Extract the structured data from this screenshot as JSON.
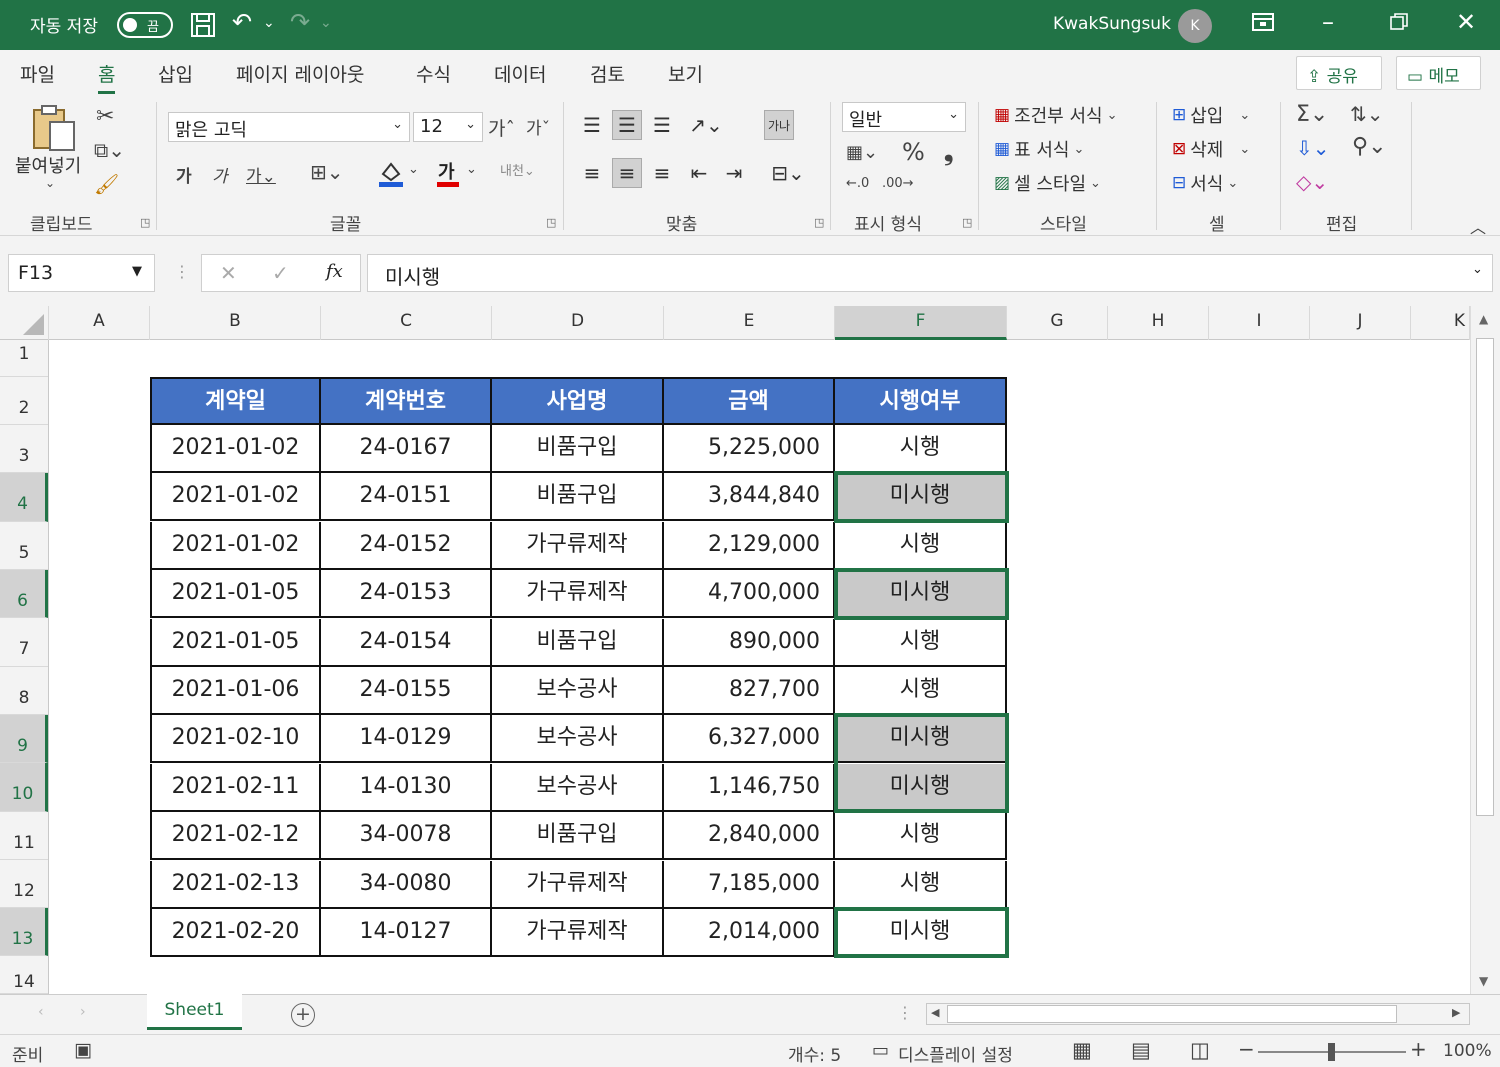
{
  "titlebar": {
    "autosave_label": "자동 저장",
    "autosave_state": "끔",
    "user_name": "KwakSungsuk",
    "avatar_initial": "K"
  },
  "menu": {
    "tabs": [
      "파일",
      "홈",
      "삽입",
      "페이지 레이아웃",
      "수식",
      "데이터",
      "검토",
      "보기"
    ],
    "active_tab": "홈",
    "share_label": "공유",
    "memo_label": "메모"
  },
  "ribbon": {
    "paste_label": "붙여넣기",
    "clipboard_group": "클립보드",
    "font_name": "맑은 고딕",
    "font_size": "12",
    "font_group": "글꼴",
    "align_group": "맞춤",
    "number_format": "일반",
    "number_group": "표시 형식",
    "cond_format": "조건부 서식",
    "table_format": "표 서식",
    "cell_style": "셀 스타일",
    "style_group": "스타일",
    "insert": "삽입",
    "delete": "삭제",
    "format": "서식",
    "cells_group": "셀",
    "edit_group": "편집"
  },
  "formula_bar": {
    "name_box": "F13",
    "formula": "미시행"
  },
  "columns": [
    "A",
    "B",
    "C",
    "D",
    "E",
    "F",
    "G",
    "H",
    "I",
    "J",
    "K"
  ],
  "selected_column": "F",
  "rows": [
    "1",
    "2",
    "3",
    "4",
    "5",
    "6",
    "7",
    "8",
    "9",
    "10",
    "11",
    "12",
    "13",
    "14"
  ],
  "selected_rows": [
    "4",
    "6",
    "9",
    "10",
    "13"
  ],
  "table": {
    "headers": [
      "계약일",
      "계약번호",
      "사업명",
      "금액",
      "시행여부"
    ],
    "rows": [
      [
        "2021-01-02",
        "24-0167",
        "비품구입",
        "5,225,000",
        "시행"
      ],
      [
        "2021-01-02",
        "24-0151",
        "비품구입",
        "3,844,840",
        "미시행"
      ],
      [
        "2021-01-02",
        "24-0152",
        "가구류제작",
        "2,129,000",
        "시행"
      ],
      [
        "2021-01-05",
        "24-0153",
        "가구류제작",
        "4,700,000",
        "미시행"
      ],
      [
        "2021-01-05",
        "24-0154",
        "비품구입",
        "890,000",
        "시행"
      ],
      [
        "2021-01-06",
        "24-0155",
        "보수공사",
        "827,700",
        "시행"
      ],
      [
        "2021-02-10",
        "14-0129",
        "보수공사",
        "6,327,000",
        "미시행"
      ],
      [
        "2021-02-11",
        "14-0130",
        "보수공사",
        "1,146,750",
        "미시행"
      ],
      [
        "2021-02-12",
        "34-0078",
        "비품구입",
        "2,840,000",
        "시행"
      ],
      [
        "2021-02-13",
        "34-0080",
        "가구류제작",
        "7,185,000",
        "시행"
      ],
      [
        "2021-02-20",
        "14-0127",
        "가구류제작",
        "2,014,000",
        "미시행"
      ]
    ],
    "header_color": "#4472c4",
    "highlight_color": "#c9c9c9",
    "selection_color": "#217346"
  },
  "sheet_tab": "Sheet1",
  "status": {
    "ready": "준비",
    "count": "개수: 5",
    "display_settings": "디스플레이 설정",
    "zoom": "100%"
  }
}
